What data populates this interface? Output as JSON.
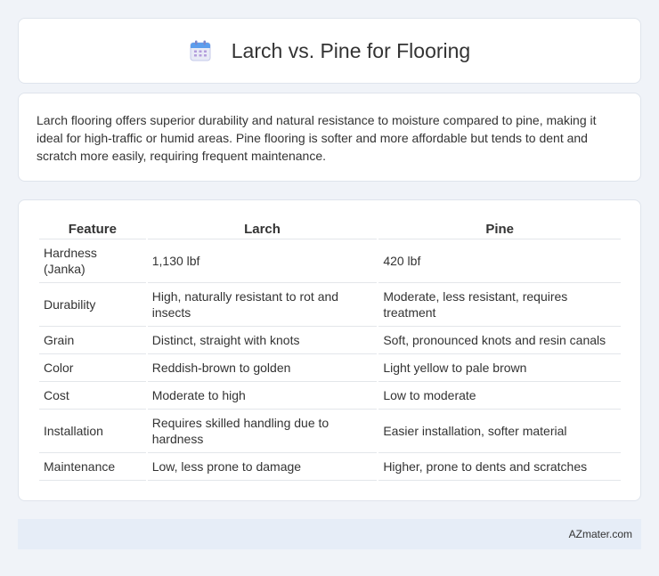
{
  "header": {
    "title": "Larch vs. Pine for Flooring",
    "icon": "calendar-icon"
  },
  "intro": {
    "text": "Larch flooring offers superior durability and natural resistance to moisture compared to pine, making it ideal for high-traffic or humid areas. Pine flooring is softer and more affordable but tends to dent and scratch more easily, requiring frequent maintenance."
  },
  "table": {
    "headers": [
      "Feature",
      "Larch",
      "Pine"
    ],
    "rows": [
      [
        "Hardness (Janka)",
        "1,130 lbf",
        "420 lbf"
      ],
      [
        "Durability",
        "High, naturally resistant to rot and insects",
        "Moderate, less resistant, requires treatment"
      ],
      [
        "Grain",
        "Distinct, straight with knots",
        "Soft, pronounced knots and resin canals"
      ],
      [
        "Color",
        "Reddish-brown to golden",
        "Light yellow to pale brown"
      ],
      [
        "Cost",
        "Moderate to high",
        "Low to moderate"
      ],
      [
        "Installation",
        "Requires skilled handling due to hardness",
        "Easier installation, softer material"
      ],
      [
        "Maintenance",
        "Low, less prone to damage",
        "Higher, prone to dents and scratches"
      ]
    ]
  },
  "footer": {
    "text": "AZmater.com"
  }
}
